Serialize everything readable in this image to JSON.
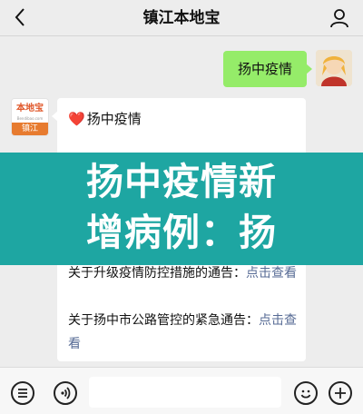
{
  "header": {
    "title": "镇江本地宝",
    "back_icon": "chevron-left-icon",
    "profile_icon": "user-icon"
  },
  "messages": {
    "outgoing": {
      "text": "扬中疫情"
    },
    "incoming": {
      "brand_logo_text": "本地宝",
      "brand_logo_url": "Bendibao.com",
      "brand_city": "镇江",
      "heart": "❤️",
      "line1": "扬中疫情",
      "items": [
        {
          "text": "关于升级疫情防控措施的通告：",
          "link": "点击查看"
        },
        {
          "text": "关于扬中市公路管控的紧急通告：",
          "link": "点击查看"
        }
      ]
    }
  },
  "banner": {
    "line1": "扬中疫情新",
    "line2": "增病例：扬",
    "color": "#1ea6a2"
  },
  "bottombar": {
    "icons": [
      "menu-icon",
      "voice-icon",
      "emoji-icon",
      "add-icon"
    ]
  },
  "colors": {
    "background": "#ededed",
    "outgoing_bubble": "#95ec69",
    "link": "#576b95",
    "banner": "#1ea6a2"
  }
}
